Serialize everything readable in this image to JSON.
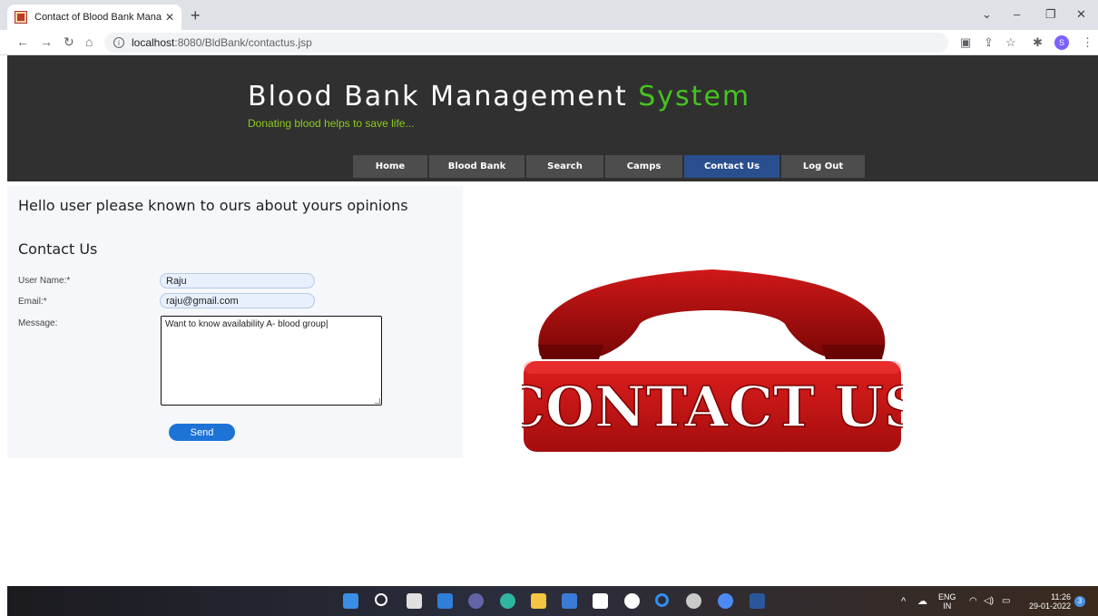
{
  "browser": {
    "tab_title": "Contact of Blood Bank Managem",
    "tab_close": "✕",
    "new_tab": "+",
    "url_host": "localhost",
    "url_path": ":8080/BldBank/contactus.jsp",
    "window_controls": [
      "⌄",
      "–",
      "❐",
      "✕"
    ]
  },
  "site": {
    "title_main": "Blood Bank Management ",
    "title_accent": "System",
    "slogan": "Donating blood helps to save life...",
    "menu": [
      {
        "label": "Home",
        "active": false
      },
      {
        "label": "Blood Bank",
        "active": false
      },
      {
        "label": "Search",
        "active": false
      },
      {
        "label": "Camps",
        "active": false
      },
      {
        "label": "Contact Us",
        "active": true
      },
      {
        "label": "Log Out",
        "active": false
      }
    ],
    "accent_color": "#46c31f",
    "active_menu_color": "#2a4f8e"
  },
  "form": {
    "greeting": "Hello user please known to ours about yours opinions",
    "heading": "Contact Us",
    "username_label": "User Name:*",
    "username_value": "Raju",
    "email_label": "Email:*",
    "email_value": "raju@gmail.com",
    "message_label": "Message:",
    "message_value": "Want to know availability A- blood group",
    "send_label": "Send"
  },
  "image": {
    "text": "CONTACT US"
  },
  "taskbar": {
    "lang_line1": "ENG",
    "lang_line2": "IN",
    "time": "11:26",
    "date": "29-01-2022",
    "notification_count": "3",
    "profile_initial": "S"
  }
}
